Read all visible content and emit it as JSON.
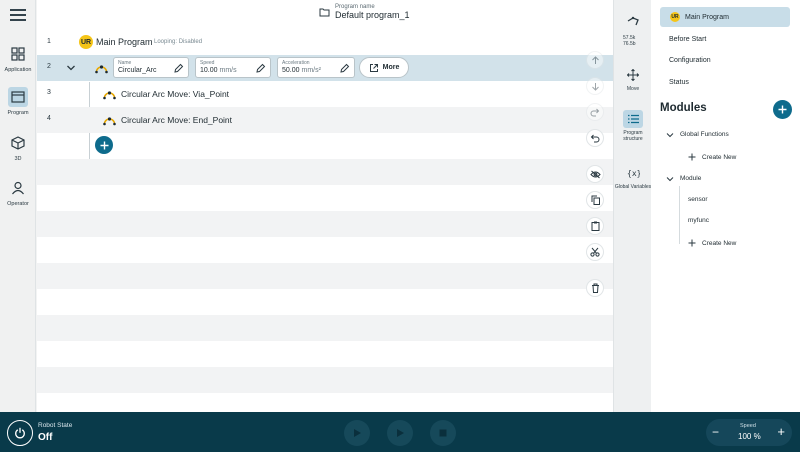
{
  "nav": {
    "items": [
      {
        "label": "Application"
      },
      {
        "label": "Program"
      },
      {
        "label": "3D"
      },
      {
        "label": "Operator"
      }
    ]
  },
  "header": {
    "caption": "Program name",
    "name": "Default program_1"
  },
  "tree": {
    "rows": [
      {
        "num": "1",
        "title": "Main Program",
        "loop": "Looping: Disabled"
      },
      {
        "num": "2",
        "fields": {
          "name": {
            "caption": "Name",
            "value": "Circular_Arc"
          },
          "speed": {
            "caption": "Speed",
            "value": "10.00",
            "unit": "mm/s"
          },
          "accel": {
            "caption": "Acceleration",
            "value": "50.00",
            "unit": "mm/s²"
          }
        },
        "more_label": "More"
      },
      {
        "num": "3",
        "text": "Circular Arc Move:  Via_Point"
      },
      {
        "num": "4",
        "text": "Circular Arc Move:  End_Point"
      }
    ]
  },
  "right_icons": {
    "coords_a": "57.5k",
    "coords_b": "76.5b",
    "move": "Move",
    "structure": "Program structure",
    "variables": "Global Variables"
  },
  "panel": {
    "main_program": "Main Program",
    "before_start": "Before Start",
    "configuration": "Configuration",
    "status": "Status",
    "modules_title": "Modules",
    "global_functions": "Global Functions",
    "create_new_1": "Create New",
    "module": "Module",
    "sensor": "sensor",
    "myfunc": "myfunc",
    "create_new_2": "Create New"
  },
  "bottom": {
    "robot_state_caption": "Robot State",
    "robot_state": "Off",
    "speed_caption": "Speed",
    "speed_value": "100 %"
  },
  "colors": {
    "accent": "#0e6b8c",
    "bottom_bar": "#093a4a",
    "selected_row": "#d2e2ea"
  }
}
